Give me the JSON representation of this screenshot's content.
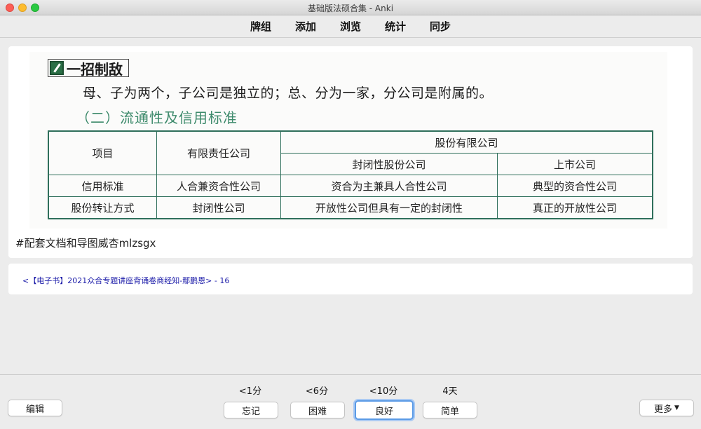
{
  "window": {
    "title": "基础版法硕合集 - Anki"
  },
  "toolbar": {
    "items": [
      "牌组",
      "添加",
      "浏览",
      "统计",
      "同步"
    ]
  },
  "card": {
    "tip_title": "一招制敌",
    "tip_text": "母、子为两个，子公司是独立的；总、分为一家，分公司是附属的。",
    "section_title": "（二）流通性及信用标准",
    "table": {
      "col_item": "项目",
      "col_llc": "有限责任公司",
      "col_jsc": "股份有限公司",
      "col_closed": "封闭性股份公司",
      "col_listed": "上市公司",
      "rows": [
        [
          "信用标准",
          "人合兼资合性公司",
          "资合为主兼具人合性公司",
          "典型的资合性公司"
        ],
        [
          "股份转让方式",
          "封闭性公司",
          "开放性公司但具有一定的封闭性",
          "真正的开放性公司"
        ]
      ]
    },
    "tag_text": "#配套文档和导图威杏mlzsgx"
  },
  "source": {
    "link_text": "<【电子书】2021众合专题讲座背诵卷商经知-鄢鹏恩>",
    "page_suffix": " - 16"
  },
  "bottom": {
    "edit_label": "编辑",
    "more_label": "更多",
    "answers": [
      {
        "interval": "<1分",
        "label": "忘记"
      },
      {
        "interval": "<6分",
        "label": "困难"
      },
      {
        "interval": "<10分",
        "label": "良好"
      },
      {
        "interval": "4天",
        "label": "简单"
      }
    ]
  },
  "colors": {
    "accent_focus": "#5b9be6",
    "table_border": "#2f6f5b",
    "section_green": "#3d8a6b",
    "link_blue": "#1a1aa8"
  }
}
